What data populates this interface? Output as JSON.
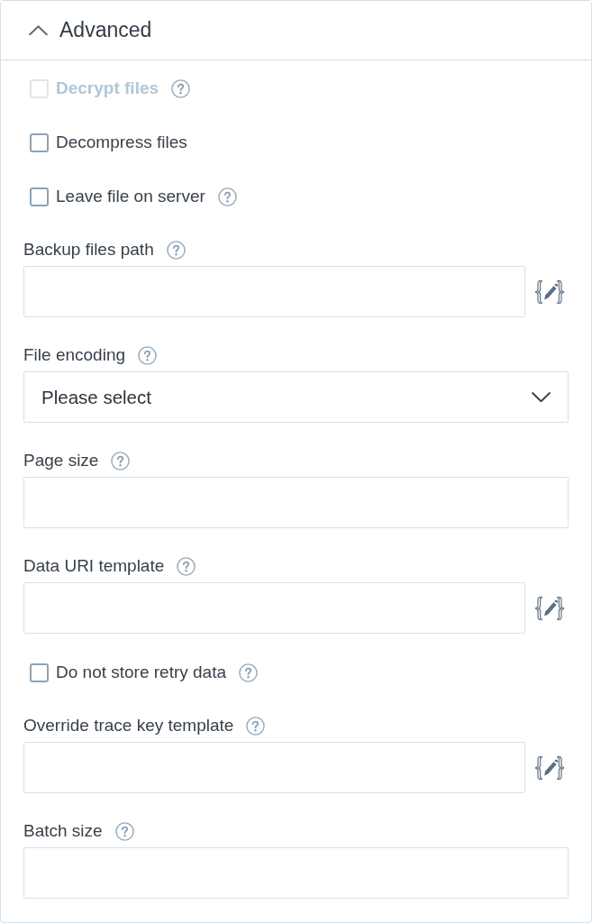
{
  "section": {
    "title": "Advanced",
    "expanded": true
  },
  "fields": [
    {
      "kind": "checkbox",
      "label": "Decrypt files",
      "checked": false,
      "disabled": true,
      "help": true
    },
    {
      "kind": "checkbox",
      "label": "Decompress files",
      "checked": false,
      "disabled": false,
      "help": false
    },
    {
      "kind": "checkbox",
      "label": "Leave file on server",
      "checked": false,
      "disabled": false,
      "help": true
    },
    {
      "kind": "text",
      "label": "Backup files path",
      "help": true,
      "variable_button": true
    },
    {
      "kind": "select",
      "label": "File encoding",
      "help": true,
      "value": "Please select"
    },
    {
      "kind": "text",
      "label": "Page size",
      "help": true,
      "variable_button": false
    },
    {
      "kind": "text",
      "label": "Data URI template",
      "help": true,
      "variable_button": true
    },
    {
      "kind": "checkbox",
      "label": "Do not store retry data",
      "checked": false,
      "disabled": false,
      "help": true
    },
    {
      "kind": "text",
      "label": "Override trace key template",
      "help": true,
      "variable_button": true
    },
    {
      "kind": "text",
      "label": "Batch size",
      "help": true,
      "variable_button": false
    }
  ]
}
